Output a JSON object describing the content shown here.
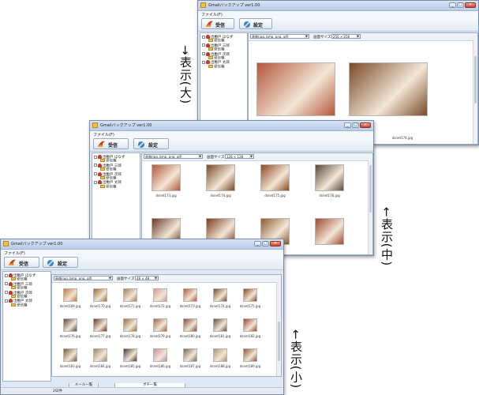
{
  "app": {
    "title": "Gmailバックアップ ver1.00",
    "menu_file": "ファイル(F)",
    "receive_label": "受信",
    "settings_label": "設定",
    "image_types": "画像(jpg, bmp, png, gif)",
    "image_size_label": "画面サイズ",
    "minimize": "_",
    "maximize": "□",
    "close": "×"
  },
  "tree": [
    {
      "label": "出敷戸 ほなず",
      "kind": "user",
      "indent": 0
    },
    {
      "label": "受信箱",
      "kind": "folder",
      "indent": 1
    },
    {
      "label": "出敷戸 三郎",
      "kind": "user",
      "indent": 0
    },
    {
      "label": "受信箱",
      "kind": "folder",
      "indent": 1
    },
    {
      "label": "出敷戸 次郎",
      "kind": "user",
      "indent": 0
    },
    {
      "label": "受信箱",
      "kind": "folder",
      "indent": 1
    },
    {
      "label": "出敷戸 太郎",
      "kind": "user",
      "indent": 0
    },
    {
      "label": "受信箱",
      "kind": "folder",
      "indent": 1
    }
  ],
  "views": {
    "large": {
      "size_value": "256 × 256",
      "callout": "→表示(大)",
      "thumbs": [
        {
          "caption": "",
          "color": "#b5573c"
        },
        {
          "caption": "",
          "color": "#7a4a28"
        }
      ],
      "partial_caption": "dsnet174.jpg"
    },
    "medium": {
      "size_value": "128 × 128",
      "callout": "←表示(中)",
      "thumbs": [
        {
          "caption": "dsnet173.jpg",
          "color": "#b5573c"
        },
        {
          "caption": "dsnet174.jpg",
          "color": "#7a4a28"
        },
        {
          "caption": "dsnet175.jpg",
          "color": "#8d4a22"
        },
        {
          "caption": "dsnet176.jpg",
          "color": "#5a4a3a"
        },
        {
          "caption": "",
          "color": "#6b3a28"
        },
        {
          "caption": "",
          "color": "#7b3b1e"
        },
        {
          "caption": "",
          "color": "#8e5a30"
        },
        {
          "caption": "",
          "color": "#9e4a30"
        }
      ]
    },
    "small": {
      "size_value": "48 × 48",
      "callout": "←表示(小)",
      "status": "2日件",
      "tab_mail": "メール一覧",
      "tab_folder": "ポチ一覧",
      "thumbs": [
        {
          "caption": "dsnet169.jpg",
          "color": "#c07a3a"
        },
        {
          "caption": "dsnet170.jpg",
          "color": "#9e6a3a"
        },
        {
          "caption": "dsnet171.jpg",
          "color": "#a88050"
        },
        {
          "caption": "dsnet172.jpg",
          "color": "#d89898"
        },
        {
          "caption": "dsnet173.jpg",
          "color": "#b5573c"
        },
        {
          "caption": "dsnet174.jpg",
          "color": "#7a4a28"
        },
        {
          "caption": "dsnet175.jpg",
          "color": "#8d4a22"
        },
        {
          "caption": "dsnet176.jpg",
          "color": "#5a4a3a"
        },
        {
          "caption": "dsnet177.jpg",
          "color": "#6b3a28"
        },
        {
          "caption": "dsnet178.jpg",
          "color": "#9a7048"
        },
        {
          "caption": "dsnet179.jpg",
          "color": "#a06848"
        },
        {
          "caption": "dsnet180.jpg",
          "color": "#8a4a32"
        },
        {
          "caption": "dsnet181.jpg",
          "color": "#6a5040"
        },
        {
          "caption": "dsnet182.jpg",
          "color": "#9e4a30"
        },
        {
          "caption": "dsnet183.jpg",
          "color": "#7a5a3a"
        },
        {
          "caption": "dsnet184.jpg",
          "color": "#a08868"
        },
        {
          "caption": "dsnet185.jpg",
          "color": "#4a3a30"
        },
        {
          "caption": "dsnet186.jpg",
          "color": "#c090a0"
        },
        {
          "caption": "dsnet187.jpg",
          "color": "#7a6a50"
        },
        {
          "caption": "dsnet188.jpg",
          "color": "#b09070"
        },
        {
          "caption": "dsnet189.jpg",
          "color": "#8a5a3a"
        }
      ]
    }
  }
}
